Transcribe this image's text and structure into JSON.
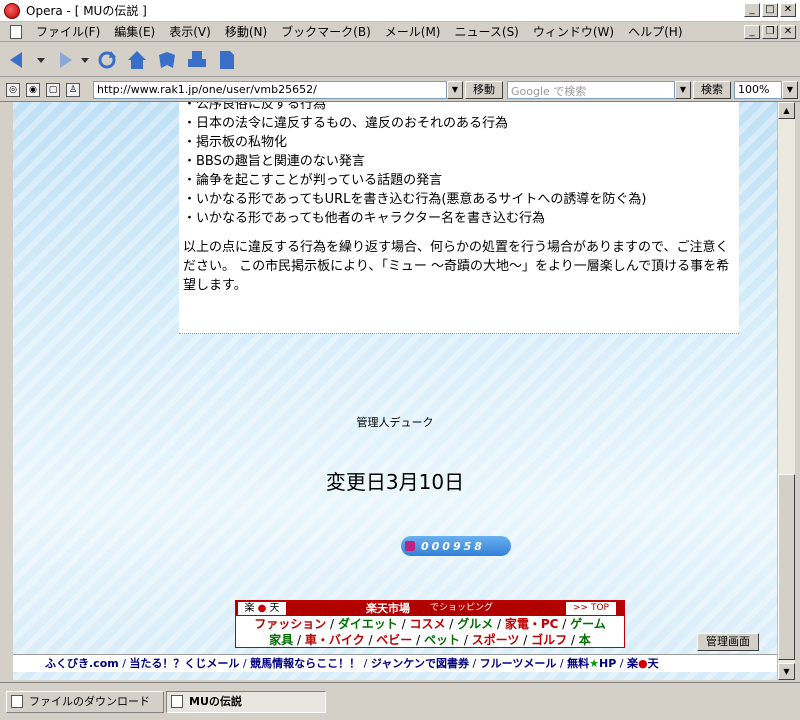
{
  "window": {
    "title": "Opera - [ MUの伝説 ]"
  },
  "menu": [
    "ファイル(F)",
    "編集(E)",
    "表示(V)",
    "移動(N)",
    "ブックマーク(B)",
    "メール(M)",
    "ニュース(S)",
    "ウィンドウ(W)",
    "ヘルプ(H)"
  ],
  "toolbar": {
    "back_icon": "back-arrow-icon",
    "forward_icon": "forward-arrow-icon",
    "reload_icon": "reload-icon",
    "home_icon": "home-icon",
    "bookmark_icon": "bookmarks-icon",
    "print_icon": "print-icon",
    "page_icon": "page-icon"
  },
  "address": {
    "url": "http://www.rak1.jp/one/user/vmb25652/",
    "go_label": "移動",
    "search_placeholder": "Google で検索",
    "search_label": "検索",
    "zoom": "100%"
  },
  "rules": {
    "lines": [
      "・公序良俗に反する行為",
      "・日本の法令に違反するもの、違反のおそれのある行為",
      "・掲示板の私物化",
      "・BBSの趣旨と関連のない発言",
      "・論争を起こすことが判っている話題の発言",
      "・いかなる形であってもURLを書き込む行為(悪意あるサイトへの誘導を防ぐ為)",
      "・いかなる形であっても他者のキャラクター名を書き込む行為"
    ],
    "paragraph": "以上の点に違反する行為を繰り返す場合、何らかの処置を行う場合がありますので、ご注意ください。 この市民掲示板により、「ミュー ～奇蹟の大地～」をより一層楽しんで頂ける事を希望します。"
  },
  "admin": {
    "name": "管理人デューク"
  },
  "change_date": "変更日3月10日",
  "counter": {
    "digits": "000958"
  },
  "ad": {
    "logo_left": "楽",
    "logo_right": "天",
    "title": "楽天市場",
    "subtitle": "でショッピング",
    "top_link": ">> TOP",
    "row1": [
      "ファッション",
      "ダイエット",
      "コスメ",
      "グルメ",
      "家電・PC",
      "ゲーム"
    ],
    "row2": [
      "家具",
      "車・バイク",
      "ベビー",
      "ペット",
      "スポーツ",
      "ゴルフ",
      "本"
    ]
  },
  "admin_button": "管理画面",
  "footer_links": [
    "ふくびき.com",
    "当たる！？くじメール",
    "競馬情報ならここ！！",
    "ジャンケンで図書券",
    "フルーツメール"
  ],
  "footer_free": "無料",
  "footer_hp": "HP",
  "footer_rakuten_left": "楽",
  "footer_rakuten_right": "天",
  "statusbar": {
    "download": "ファイルのダウンロード",
    "page": "MUの伝説"
  }
}
